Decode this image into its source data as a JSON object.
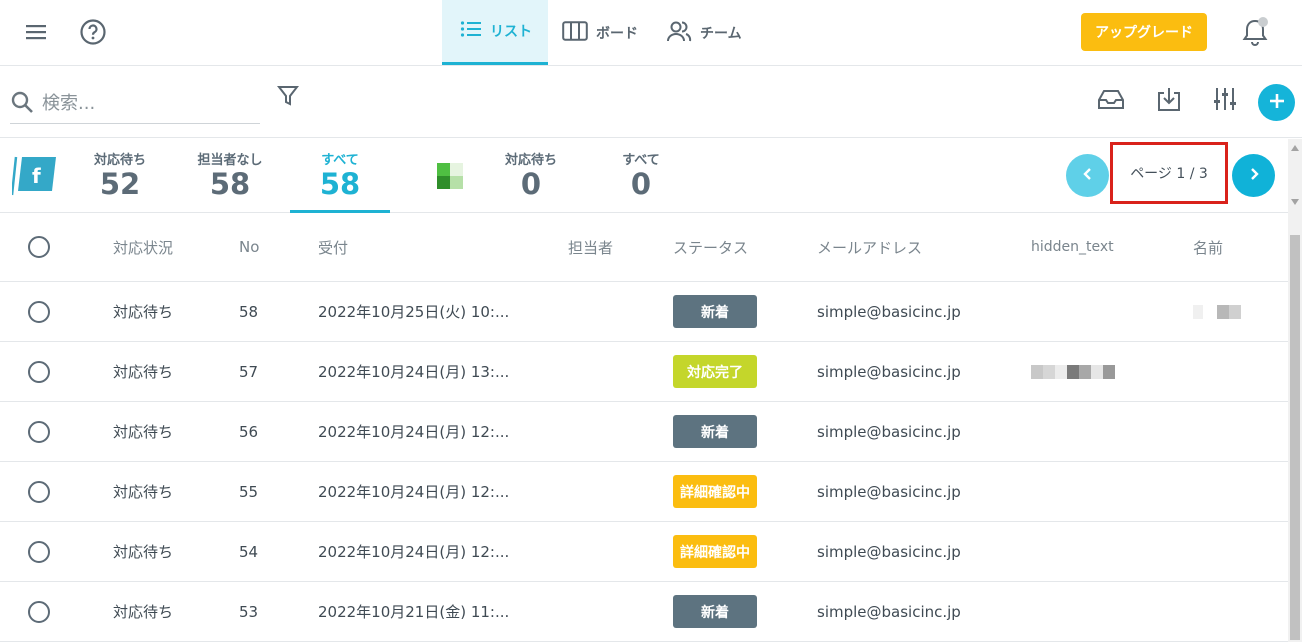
{
  "header": {
    "tabs": [
      {
        "label": "リスト",
        "icon": "list-icon",
        "active": true
      },
      {
        "label": "ボード",
        "icon": "board-icon",
        "active": false
      },
      {
        "label": "チーム",
        "icon": "team-icon",
        "active": false
      }
    ],
    "upgrade_label": "アップグレード",
    "colors": {
      "accent": "#1eb2d3",
      "upgrade": "#fbbd10"
    }
  },
  "toolbar": {
    "search_placeholder": "検索..."
  },
  "stats": {
    "groups": [
      {
        "label": "対応待ち",
        "value": "52",
        "active": false
      },
      {
        "label": "担当者なし",
        "value": "58",
        "active": false
      },
      {
        "label": "すべて",
        "value": "58",
        "active": true
      },
      {
        "label": "対応待ち",
        "value": "0",
        "active": false
      },
      {
        "label": "すべて",
        "value": "0",
        "active": false
      }
    ],
    "page_label": "ページ 1 / 3"
  },
  "table": {
    "columns": [
      "対応状況",
      "No",
      "受付",
      "担当者",
      "ステータス",
      "メールアドレス",
      "hidden_text",
      "名前"
    ],
    "rows": [
      {
        "status": "対応待ち",
        "no": "58",
        "date": "2022年10月25日(火) 10:...",
        "badge": "新着",
        "badge_color": "#5d7380",
        "email": "simple@basicinc.jp"
      },
      {
        "status": "対応待ち",
        "no": "57",
        "date": "2022年10月24日(月) 13:...",
        "badge": "対応完了",
        "badge_color": "#c4d62b",
        "email": "simple@basicinc.jp"
      },
      {
        "status": "対応待ち",
        "no": "56",
        "date": "2022年10月24日(月) 12:...",
        "badge": "新着",
        "badge_color": "#5d7380",
        "email": "simple@basicinc.jp"
      },
      {
        "status": "対応待ち",
        "no": "55",
        "date": "2022年10月24日(月) 12:...",
        "badge": "詳細確認中",
        "badge_color": "#fbbd10",
        "email": "simple@basicinc.jp"
      },
      {
        "status": "対応待ち",
        "no": "54",
        "date": "2022年10月24日(月) 12:...",
        "badge": "詳細確認中",
        "badge_color": "#fbbd10",
        "email": "simple@basicinc.jp"
      },
      {
        "status": "対応待ち",
        "no": "53",
        "date": "2022年10月21日(金) 11:...",
        "badge": "新着",
        "badge_color": "#5d7380",
        "email": "simple@basicinc.jp"
      }
    ]
  }
}
